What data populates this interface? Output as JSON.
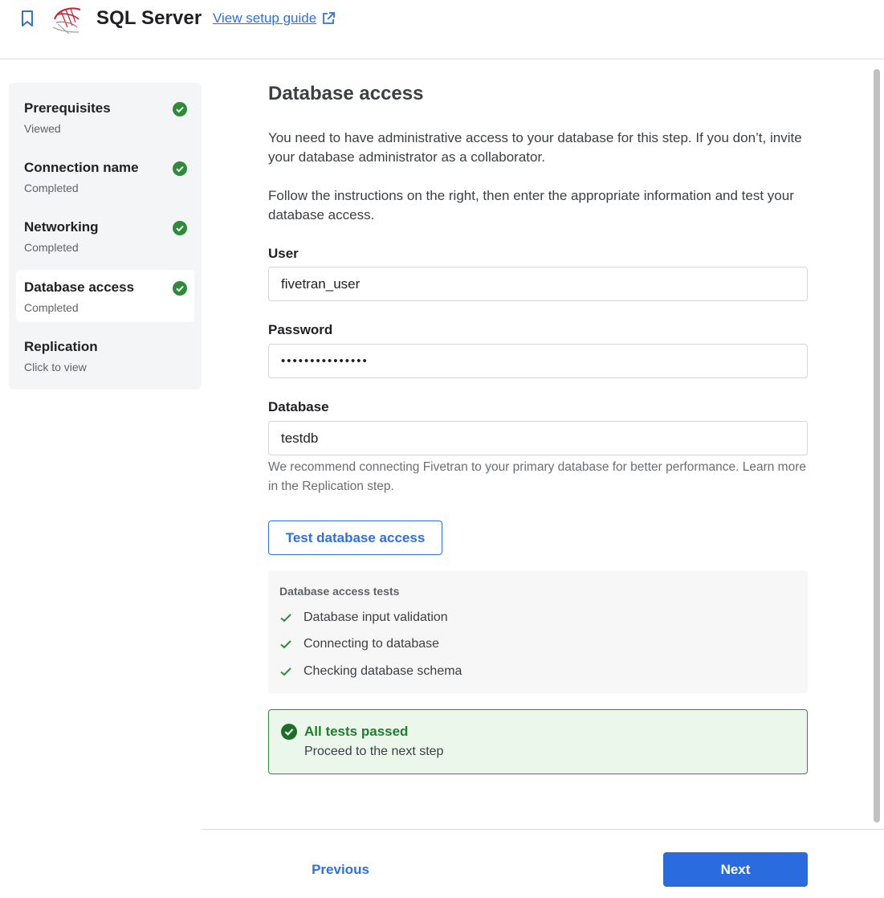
{
  "header": {
    "title": "SQL Server",
    "guide_link": "View setup guide",
    "icons": [
      "bookmark-icon",
      "sql-server-logo",
      "external-link-icon"
    ]
  },
  "sidebar": {
    "steps": [
      {
        "title": "Prerequisites",
        "status": "Viewed",
        "checked": true
      },
      {
        "title": "Connection name",
        "status": "Completed",
        "checked": true
      },
      {
        "title": "Networking",
        "status": "Completed",
        "checked": true
      },
      {
        "title": "Database access",
        "status": "Completed",
        "checked": true,
        "active": true
      },
      {
        "title": "Replication",
        "status": "Click to view",
        "checked": false
      }
    ]
  },
  "main": {
    "title": "Database access",
    "intro": "You need to have administrative access to your database for this step. If you don’t, invite your database administrator as a collaborator.",
    "instructions": "Follow the instructions on the right, then enter the appropriate information and test your database access.",
    "fields": {
      "user": {
        "label": "User",
        "value": "fivetran_user"
      },
      "password": {
        "label": "Password",
        "value": "•••••••••••••••"
      },
      "database": {
        "label": "Database",
        "value": "testdb"
      }
    },
    "helper": "We recommend connecting Fivetran to your primary database for better performance. Learn more in the Replication step.",
    "test_button": "Test database access",
    "tests": {
      "title": "Database access tests",
      "items": [
        "Database input validation",
        "Connecting to database",
        "Checking database schema"
      ]
    },
    "result": {
      "title": "All tests passed",
      "subtitle": "Proceed to the next step"
    }
  },
  "footer": {
    "previous": "Previous",
    "next": "Next"
  },
  "colors": {
    "accent": "#2f6fdf",
    "success": "#2e8b3a",
    "success_bg": "#ecf7ec",
    "logo_red": "#c8202f"
  }
}
